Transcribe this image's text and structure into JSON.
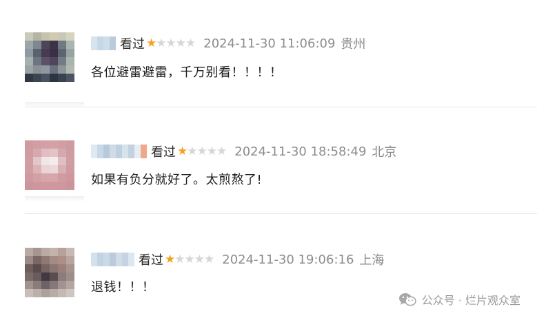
{
  "comments": [
    {
      "status": "看过",
      "rating": 1,
      "max_rating": 5,
      "timestamp": "2024-11-30 11:06:09",
      "location": "贵州",
      "text": "各位避雷避雷，千万别看！！！！"
    },
    {
      "status": "看过",
      "rating": 1,
      "max_rating": 5,
      "timestamp": "2024-11-30 18:58:49",
      "location": "北京",
      "text": "如果有负分就好了。太煎熬了!"
    },
    {
      "status": "看过",
      "rating": 1,
      "max_rating": 5,
      "timestamp": "2024-11-30 19:06:16",
      "location": "上海",
      "text": "退钱！！！"
    }
  ],
  "watermark": {
    "icon": "wechat-icon",
    "text": "公众号 · 烂片观众室"
  },
  "colors": {
    "star_on": "#f2a21b",
    "star_off": "#d6d6d6",
    "meta_gray": "#8c8c8c"
  }
}
